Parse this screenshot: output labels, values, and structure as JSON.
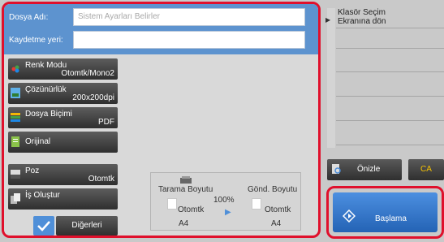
{
  "header": {
    "filename_label": "Dosya Adı:",
    "filename_placeholder": "Sistem Ayarları Belirler",
    "save_location_label": "Kaydetme yeri:",
    "save_location_value": ""
  },
  "settings": [
    {
      "label": "Renk Modu",
      "value": "Otomtk/Mono2",
      "icon": "color-mode-icon"
    },
    {
      "label": "Çözünürlük",
      "value": "200x200dpi",
      "icon": "resolution-icon"
    },
    {
      "label": "Dosya Biçimi",
      "value": "PDF",
      "icon": "file-format-icon"
    },
    {
      "label": "Orijinal",
      "value": "",
      "icon": "original-icon"
    },
    {
      "label": "Poz",
      "value": "Otomtk",
      "icon": "exposure-icon"
    },
    {
      "label": "İş Oluştur",
      "value": "",
      "icon": "job-build-icon"
    }
  ],
  "others_label": "Diğerleri",
  "preview": {
    "scan_size_label": "Tarama Boyutu",
    "send_size_label": "Gönd. Boyutu",
    "scale": "100%",
    "scan_value": "Otomtk",
    "send_value": "Otomtk",
    "scan_paper": "A4",
    "send_paper": "A4"
  },
  "right": {
    "folder_link_line1": "Klasör Seçim",
    "folder_link_line2": "Ekranına dön",
    "preview_button": "Önizle",
    "ca_button": "CA",
    "start_button": "Başlama"
  },
  "colors": {
    "header_blue": "#5d93cf",
    "highlight_red": "#e0102c",
    "start_blue": "#2f74c6",
    "ca_yellow": "#f7c200"
  }
}
